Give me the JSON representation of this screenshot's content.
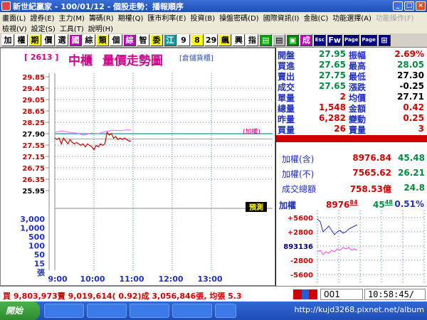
{
  "window": {
    "title": "新世紀贏家 - 100/01/12 - 個股走勢：播報順序",
    "buttons": [
      "_",
      "□",
      "×"
    ]
  },
  "menu": {
    "row1": [
      {
        "label": "畫面(L)",
        "dim": false
      },
      {
        "label": "證券(E)",
        "dim": false
      },
      {
        "label": "主力(M)",
        "dim": false
      },
      {
        "label": "籌碼(R)",
        "dim": false
      },
      {
        "label": "期權(Q)",
        "dim": false
      },
      {
        "label": "匯市利率(E)",
        "dim": false
      },
      {
        "label": "投資(B)",
        "dim": false
      },
      {
        "label": "操盤密碼(D)",
        "dim": false
      },
      {
        "label": "國際資訊(I)",
        "dim": false
      },
      {
        "label": "金融(C)",
        "dim": false
      },
      {
        "label": "功能選擇(A)",
        "dim": false
      },
      {
        "label": "功能操作(F)",
        "dim": true
      }
    ],
    "row2": [
      {
        "label": "檢視(V)",
        "dim": false
      },
      {
        "label": "設定(S)",
        "dim": false
      },
      {
        "label": "工具(T)",
        "dim": false
      },
      {
        "label": "說明(H)",
        "dim": false
      }
    ]
  },
  "toolbar": {
    "buttons": [
      {
        "label": "加",
        "bg": "#ffffff",
        "fg": "#000000"
      },
      {
        "label": "權",
        "bg": "#ffffff",
        "fg": "#000000"
      },
      {
        "label": "期",
        "bg": "#ffff00",
        "fg": "#000000"
      },
      {
        "label": "價",
        "bg": "#ffffff",
        "fg": "#000000"
      },
      {
        "label": "選",
        "bg": "#ffffff",
        "fg": "#000000"
      },
      {
        "label": "國",
        "bg": "#c000c0",
        "fg": "#ffffff"
      },
      {
        "label": "綜",
        "bg": "#ffffff",
        "fg": "#000000"
      },
      {
        "label": "類",
        "bg": "#ffff00",
        "fg": "#000000"
      },
      {
        "label": "個",
        "bg": "#ffffff",
        "fg": "#000000"
      },
      {
        "label": "綜",
        "bg": "#c000c0",
        "fg": "#ffffff"
      },
      {
        "label": "智",
        "bg": "#ffffff",
        "fg": "#000000"
      },
      {
        "label": "委",
        "bg": "#ffff00",
        "fg": "#000000"
      },
      {
        "label": "江",
        "bg": "#00a0a0",
        "fg": "#ffffff"
      },
      {
        "label": "9",
        "bg": "#ffffff",
        "fg": "#000000"
      },
      {
        "label": "8",
        "bg": "#ffff00",
        "fg": "#000000"
      },
      {
        "label": "29",
        "bg": "#ffffff",
        "fg": "#000000"
      },
      {
        "label": "飆",
        "bg": "#ffff00",
        "fg": "#000000"
      },
      {
        "label": "興",
        "bg": "#ffffff",
        "fg": "#000000"
      },
      {
        "label": "指",
        "bg": "#ffffff",
        "fg": "#000000"
      },
      {
        "label": "▤",
        "bg": "#00a000",
        "fg": "#ffffff"
      },
      {
        "label": "▤",
        "bg": "#c0c0c0",
        "fg": "#000000"
      },
      {
        "label": "▣",
        "bg": "#008000",
        "fg": "#ffffff"
      },
      {
        "label": "成",
        "bg": "#c000c0",
        "fg": "#ffffff"
      },
      {
        "label": "Esc",
        "bg": "#000080",
        "fg": "#ffffff"
      },
      {
        "label": "Fw",
        "bg": "#000080",
        "fg": "#ffffff"
      },
      {
        "label": "Page",
        "bg": "#000080",
        "fg": "#ffffff"
      },
      {
        "label": "Page",
        "bg": "#000080",
        "fg": "#ffffff"
      },
      {
        "label": "⊞",
        "bg": "#000080",
        "fg": "#ffffff"
      }
    ]
  },
  "chart": {
    "code": "[ 2613 ]",
    "name": "中櫃",
    "title": "量價走勢圖",
    "subtitle": "[倉儲貨櫃]",
    "ref_label": "(加權)",
    "tag": "預測"
  },
  "chart_data": {
    "type": "line",
    "price_ticks": [
      "29.85",
      "29.45",
      "29.05",
      "28.65",
      "28.25",
      "27.90",
      "27.55",
      "27.15",
      "26.75",
      "26.35",
      "25.95"
    ],
    "volume_ticks": [
      "3,000",
      "1,000",
      "500",
      "100",
      "50",
      "15",
      "張"
    ],
    "time_ticks": [
      "9:00",
      "10:00",
      "11:00",
      "12:00",
      "13:00"
    ],
    "reference_price": 27.9,
    "ylim": [
      25.95,
      29.85
    ],
    "price": [
      [
        0,
        27.75
      ],
      [
        3,
        27.7
      ],
      [
        6,
        27.75
      ],
      [
        9,
        27.55
      ],
      [
        12,
        27.75
      ],
      [
        15,
        27.65
      ],
      [
        18,
        27.55
      ],
      [
        21,
        27.7
      ],
      [
        24,
        27.6
      ],
      [
        27,
        27.55
      ],
      [
        30,
        27.6
      ],
      [
        33,
        27.55
      ],
      [
        36,
        27.5
      ],
      [
        39,
        27.55
      ],
      [
        42,
        27.45
      ],
      [
        45,
        27.55
      ],
      [
        48,
        27.5
      ],
      [
        51,
        27.45
      ],
      [
        54,
        27.35
      ],
      [
        57,
        27.5
      ],
      [
        60,
        27.45
      ],
      [
        63,
        27.55
      ],
      [
        66,
        27.5
      ],
      [
        69,
        27.55
      ],
      [
        72,
        27.95
      ],
      [
        75,
        27.85
      ],
      [
        78,
        27.9
      ],
      [
        81,
        27.75
      ],
      [
        84,
        27.8
      ],
      [
        87,
        27.7
      ],
      [
        90,
        27.75
      ],
      [
        93,
        27.7
      ],
      [
        96,
        27.75
      ],
      [
        99,
        27.7
      ],
      [
        102,
        27.65
      ],
      [
        105,
        27.65
      ]
    ],
    "index_overlay": [
      [
        0,
        27.95
      ],
      [
        10,
        28.0
      ],
      [
        20,
        27.95
      ],
      [
        30,
        27.92
      ],
      [
        40,
        27.85
      ],
      [
        50,
        27.92
      ],
      [
        60,
        27.9
      ],
      [
        70,
        27.98
      ],
      [
        80,
        28.02
      ],
      [
        90,
        28.0
      ],
      [
        100,
        28.03
      ],
      [
        105,
        28.02
      ]
    ]
  },
  "quote": {
    "left": [
      {
        "label": "開盤",
        "value": "27.95",
        "color": "green"
      },
      {
        "label": "買進",
        "value": "27.65",
        "color": "green"
      },
      {
        "label": "賣出",
        "value": "27.75",
        "color": "green"
      },
      {
        "label": "成交",
        "value": "27.65",
        "color": "green"
      },
      {
        "label": "單量",
        "value": "2",
        "color": "red"
      },
      {
        "label": "總量",
        "value": "1,548",
        "color": "red"
      },
      {
        "label": "昨量",
        "value": "6,282",
        "color": "red"
      },
      {
        "label": "買量",
        "value": "26",
        "color": "red"
      }
    ],
    "right": [
      {
        "label": "振幅",
        "value": "2.69%",
        "color": "red"
      },
      {
        "label": "最高",
        "value": "28.05",
        "color": "green"
      },
      {
        "label": "最低",
        "value": "27.30",
        "color": "black"
      },
      {
        "label": "漲跌",
        "value": "-0.25",
        "color": "black"
      },
      {
        "label": "均價",
        "value": "27.71",
        "color": "black"
      },
      {
        "label": "金額",
        "value": "0.42",
        "color": "red"
      },
      {
        "label": "變動",
        "value": "0.25",
        "color": "red"
      },
      {
        "label": "賣量",
        "value": "3",
        "color": "red"
      }
    ]
  },
  "index": {
    "rows": [
      {
        "label": "加權(含)",
        "value": "8976.84",
        "change": "45.48"
      },
      {
        "label": "加權(不)",
        "value": "7565.62",
        "change": "26.21"
      },
      {
        "label": "成交總額",
        "value": "758.53億",
        "change": "24.8"
      }
    ],
    "mini": {
      "label": "加權",
      "value_main": "8976",
      "value_frac": "84",
      "chg_main": "45",
      "chg_frac": "48",
      "pct": "0.51%",
      "ticks": [
        "+5600",
        "+2800",
        "893136",
        "-2800",
        "-5600"
      ]
    }
  },
  "status": {
    "text": "買 9,803,973賣 9,019,614( 0.92)成 3,056,846張, 均張 5.3",
    "code": "001",
    "time": "10:58:45/"
  },
  "taskbar": {
    "start_label": "開始",
    "watermark": "http://kujd3268.pixnet.net/album"
  },
  "colors": {
    "price_line": "#d00000",
    "index_line": "#ff60ff",
    "ref_line": "#00a0a0",
    "label_blue": "#2030c0"
  }
}
